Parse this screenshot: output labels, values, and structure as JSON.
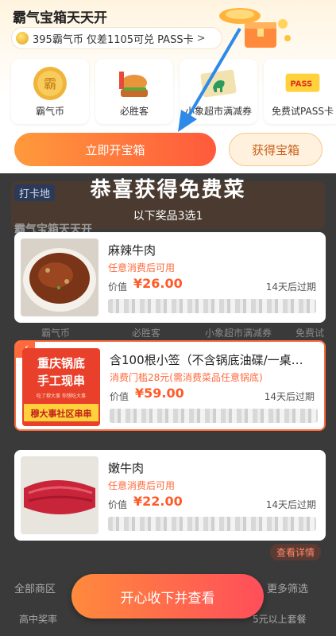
{
  "panel": {
    "title": "霸气宝箱天天开",
    "coin_text": "395霸气币 仅差1105可兑 PASS卡",
    "coin_chevron": ">",
    "rewards": [
      {
        "label": "霸气币",
        "icon": "coin-icon"
      },
      {
        "label": "必胜客",
        "icon": "burger-icon"
      },
      {
        "label": "小象超市满减券",
        "icon": "coupon-icon"
      },
      {
        "label": "免费试PASS卡",
        "icon": "pass-card-icon",
        "card_text": "PASS"
      }
    ],
    "open_button": "立即开宝箱",
    "get_button": "获得宝箱"
  },
  "background": {
    "checkin_label": "打卡地",
    "section_title": "霸气宝箱天天开",
    "row_labels": [
      "霸气币",
      "必胜客",
      "小象超市满减券",
      "免费试PAS"
    ],
    "filter_left": "全部商区",
    "filter_right": "更多筛选",
    "bottom_left": "高中奖率",
    "bottom_right": "5元以上套餐",
    "see_more": "查看详情"
  },
  "modal": {
    "title": "恭喜获得免费菜",
    "subtitle": "以下奖品3选1",
    "items": [
      {
        "name": "麻辣牛肉",
        "condition": "任意消费后可用",
        "price_label": "价值",
        "price": "¥26.00",
        "expire": "14天后过期",
        "selected": false
      },
      {
        "name": "含100根小签（不含锅底油碟/一桌…",
        "condition": "消费门槛28元(需消费菜品任意锅底)",
        "price_label": "价值",
        "price": "¥59.00",
        "expire": "14天后过期",
        "selected": true,
        "poster_lines": [
          "重庆锅底",
          "手工现串",
          "吃了穆大事 你想吃大事",
          "穆大事社区串串"
        ]
      },
      {
        "name": "嫩牛肉",
        "condition": "任意消费后可用",
        "price_label": "价值",
        "price": "¥22.00",
        "expire": "14天后过期",
        "selected": false
      }
    ],
    "accept_button": "开心收下并查看",
    "check_mark": "✓"
  },
  "colors": {
    "accent": "#ff6a3c",
    "price": "#ff5a28",
    "overlay": "#3a3a3a"
  }
}
